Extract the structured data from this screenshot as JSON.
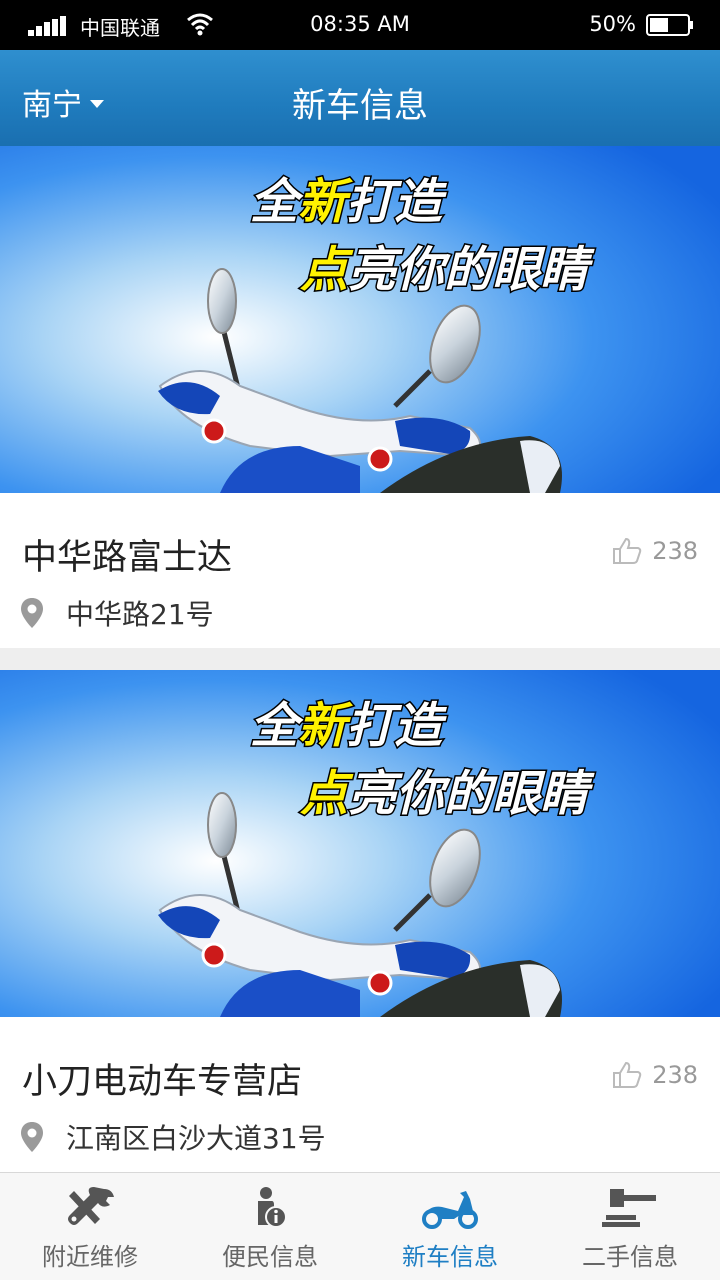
{
  "status_bar": {
    "carrier": "中国联通",
    "time": "08:35 AM",
    "battery": "50%",
    "battery_level": 0.5
  },
  "header": {
    "city": "南宁",
    "title": "新车信息"
  },
  "banner_text": {
    "line1": "全新打造",
    "line2": "点亮你的眼睛"
  },
  "cards": [
    {
      "name": "中华路富士达",
      "likes": "238",
      "address": "中华路21号"
    },
    {
      "name": "小刀电动车专营店",
      "likes": "238",
      "address": "江南区白沙大道31号"
    }
  ],
  "tabs": [
    {
      "label": "附近维修",
      "icon": "tools-icon"
    },
    {
      "label": "便民信息",
      "icon": "info-person-icon"
    },
    {
      "label": "新车信息",
      "icon": "scooter-icon"
    },
    {
      "label": "二手信息",
      "icon": "gavel-icon"
    }
  ],
  "colors": {
    "accent": "#1f7fc4",
    "header": "#1f7bbd",
    "banner_blue": "#1a6fe6",
    "highlight_yellow": "#fff200"
  }
}
